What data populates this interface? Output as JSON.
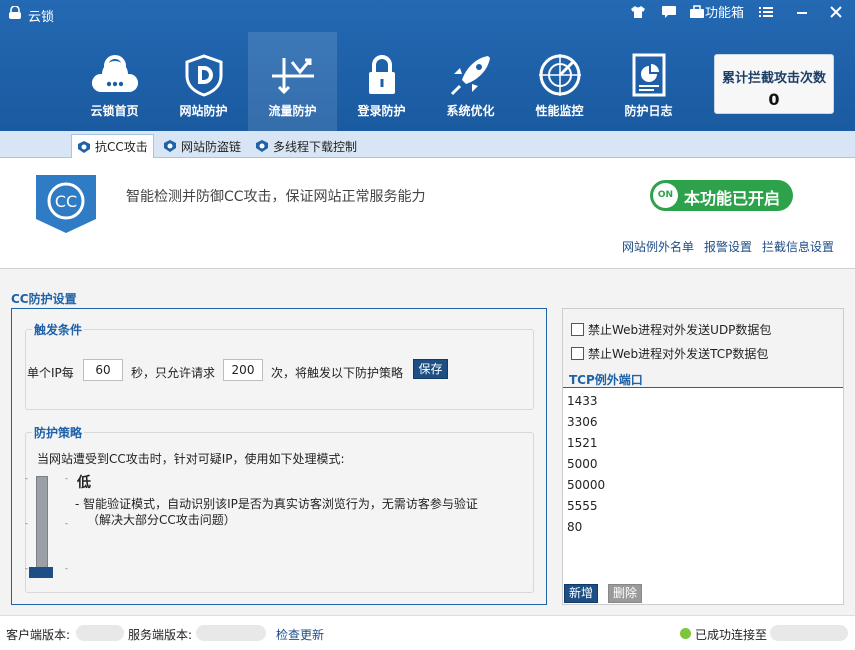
{
  "app": {
    "title": "云锁"
  },
  "titlebar": {
    "toolbox_label": "功能箱"
  },
  "nav": {
    "items": [
      {
        "label": "云锁首页"
      },
      {
        "label": "网站防护"
      },
      {
        "label": "流量防护"
      },
      {
        "label": "登录防护"
      },
      {
        "label": "系统优化"
      },
      {
        "label": "性能监控"
      },
      {
        "label": "防护日志"
      }
    ]
  },
  "counter": {
    "label": "累计拦截攻击次数",
    "value": "0"
  },
  "tabs": [
    {
      "label": "抗CC攻击"
    },
    {
      "label": "网站防盗链"
    },
    {
      "label": "多线程下载控制"
    }
  ],
  "banner": {
    "logo_text": "CC",
    "description": "智能检测并防御CC攻击，保证网站正常服务能力",
    "toggle_knob": "ON",
    "toggle_text": "本功能已开启",
    "links": [
      "网站例外名单",
      "报警设置",
      "拦截信息设置"
    ]
  },
  "settings": {
    "title": "CC防护设置",
    "trigger": {
      "title": "触发条件",
      "prefix": "单个IP每",
      "seconds": "60",
      "mid": "秒，只允许请求",
      "requests": "200",
      "suffix": "次，将触发以下防护策略",
      "save_label": "保存"
    },
    "strategy": {
      "title": "防护策略",
      "intro": "当网站遭受到CC攻击时，针对可疑IP，使用如下处理模式:",
      "level": "低",
      "level_desc": "- 智能验证模式，自动识别该IP是否为真实访客浏览行为，无需访客参与验证",
      "level_note": "（解决大部分CC攻击问题）",
      "level_value": 0
    }
  },
  "right": {
    "udp_label": "禁止Web进程对外发送UDP数据包",
    "tcp_label": "禁止Web进程对外发送TCP数据包",
    "ports_title": "TCP例外端口",
    "ports": [
      "1433",
      "3306",
      "1521",
      "5000",
      "50000",
      "5555",
      "80"
    ],
    "add_label": "新增",
    "delete_label": "删除"
  },
  "status": {
    "client_version_label": "客户端版本:",
    "server_version_label": "服务端版本:",
    "check_update": "检查更新",
    "connected": "已成功连接至"
  },
  "colors": {
    "header": "#1b5fa8",
    "accent": "#1f62a8",
    "on": "#2ea24a"
  }
}
